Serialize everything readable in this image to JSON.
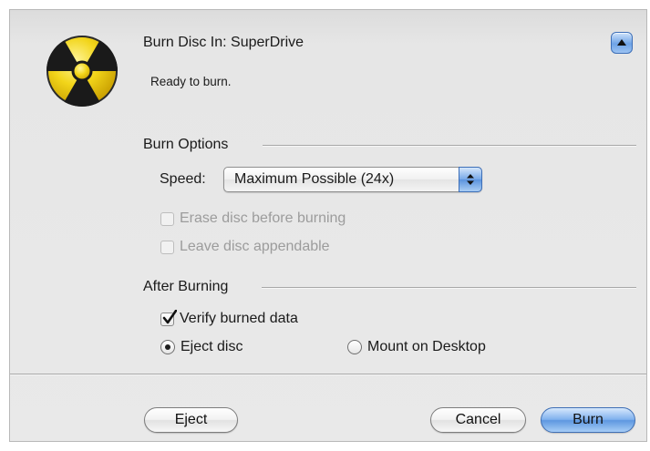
{
  "dialog": {
    "title": "Burn Disc In:  SuperDrive",
    "status": "Ready to burn.",
    "icon": "radiation-hazard-icon",
    "disclosure_icon": "disclosure-triangle-up-icon"
  },
  "burn_options": {
    "heading": "Burn Options",
    "speed_label": "Speed:",
    "speed_value": "Maximum Possible (24x)",
    "erase_label": "Erase disc before burning",
    "erase_checked": false,
    "erase_enabled": false,
    "appendable_label": "Leave disc appendable",
    "appendable_checked": false,
    "appendable_enabled": false
  },
  "after_burning": {
    "heading": "After Burning",
    "verify_label": "Verify burned data",
    "verify_checked": true,
    "eject_label": "Eject disc",
    "eject_selected": true,
    "mount_label": "Mount on Desktop",
    "mount_selected": false
  },
  "buttons": {
    "eject": "Eject",
    "cancel": "Cancel",
    "burn": "Burn"
  },
  "colors": {
    "accent": "#6ea3e6",
    "hazard_yellow": "#f2d51a",
    "hazard_black": "#1a1a1a"
  }
}
